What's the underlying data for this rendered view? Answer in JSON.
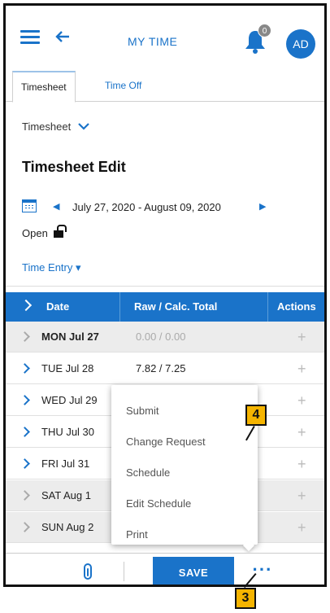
{
  "header": {
    "app_title": "MY TIME",
    "notification_count": "0",
    "avatar_initials": "AD"
  },
  "tabs": [
    {
      "label": "Timesheet",
      "active": true
    },
    {
      "label": "Time Off",
      "active": false
    }
  ],
  "view_selector": {
    "label": "Timesheet"
  },
  "page_title": "Timesheet Edit",
  "period": {
    "range": "July 27, 2020 - August 09, 2020",
    "status": "Open"
  },
  "entry_mode": {
    "label": "Time Entry ▾"
  },
  "table": {
    "headers": [
      "Date",
      "Raw / Calc. Total",
      "Actions"
    ],
    "rows": [
      {
        "date": "MON Jul 27",
        "total": "0.00 / 0.00"
      },
      {
        "date": "TUE Jul 28",
        "total": "7.82 / 7.25"
      },
      {
        "date": "WED Jul 29",
        "total": ""
      },
      {
        "date": "THU Jul 30",
        "total": ""
      },
      {
        "date": "FRI Jul 31",
        "total": ""
      },
      {
        "date": "SAT Aug 1",
        "total": ""
      },
      {
        "date": "SUN Aug 2",
        "total": ""
      }
    ]
  },
  "menu": {
    "items": [
      "Submit",
      "Change Request",
      "Schedule",
      "Edit Schedule",
      "Print"
    ]
  },
  "footer": {
    "save_label": "SAVE",
    "more_label": "···"
  },
  "callouts": {
    "menu_step": "4",
    "more_step": "3"
  },
  "colors": {
    "accent": "#1a73c9",
    "callout": "#f5b400"
  }
}
